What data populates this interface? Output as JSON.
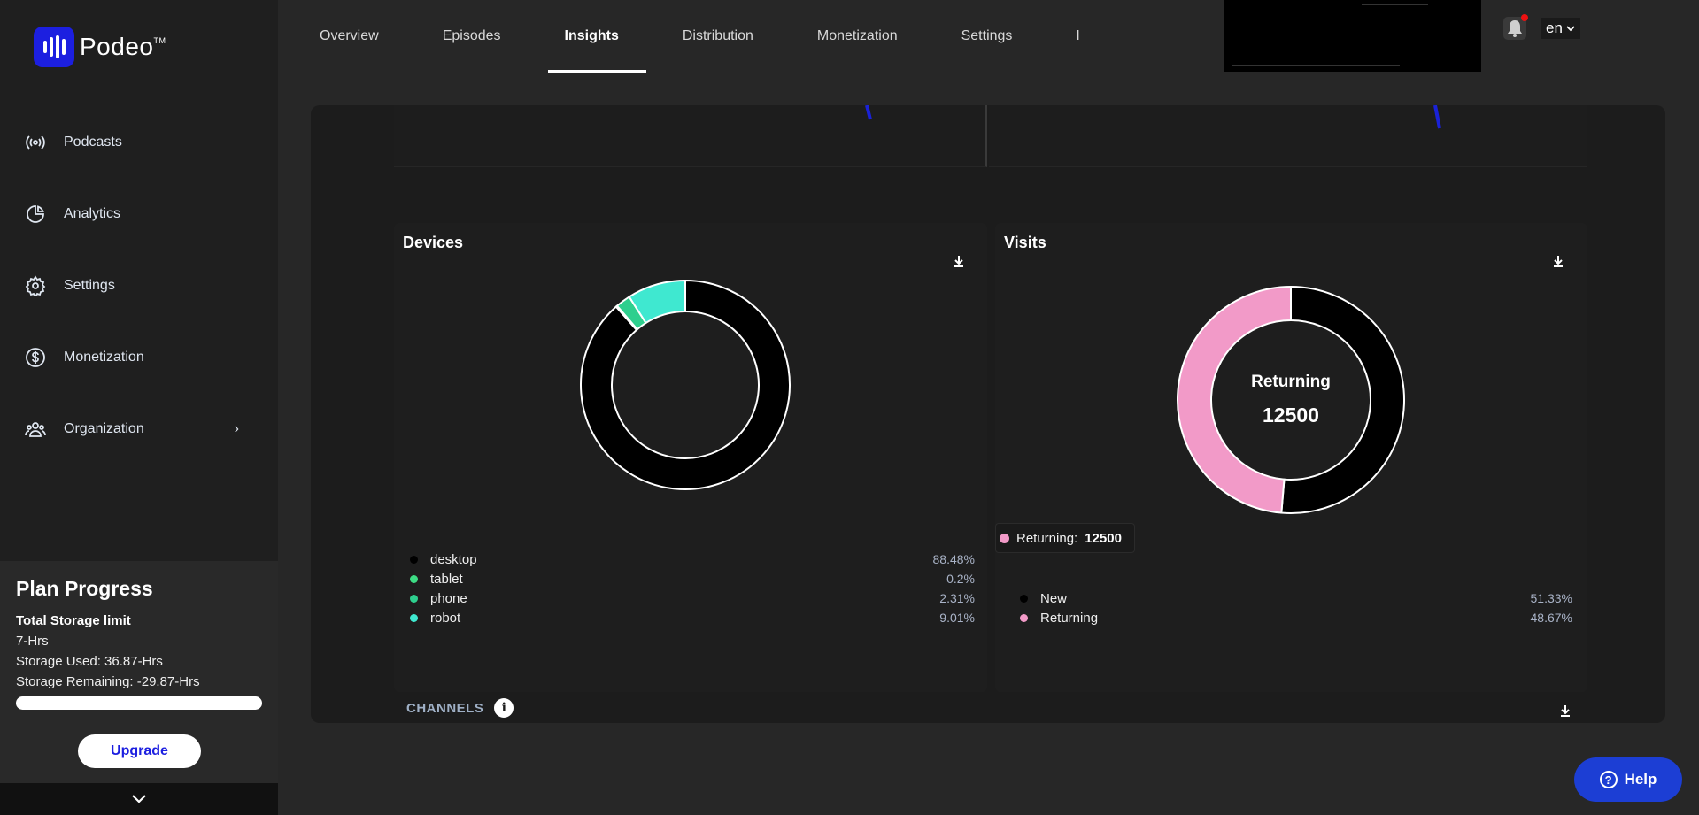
{
  "brand": {
    "name": "Podeo",
    "tm": "TM"
  },
  "sidebar": {
    "items": [
      {
        "label": "Podcasts",
        "icon": "broadcast-icon"
      },
      {
        "label": "Analytics",
        "icon": "pie-chart-icon"
      },
      {
        "label": "Settings",
        "icon": "gear-icon"
      },
      {
        "label": "Monetization",
        "icon": "dollar-icon"
      },
      {
        "label": "Organization",
        "icon": "people-icon"
      }
    ],
    "plan": {
      "title": "Plan Progress",
      "storage_title": "Total Storage limit",
      "limit": "7-Hrs",
      "used": "Storage Used: 36.87-Hrs",
      "remaining": "Storage Remaining: -29.87-Hrs",
      "progress_fraction": 1.0,
      "upgrade_label": "Upgrade"
    }
  },
  "tabs": [
    {
      "label": "Overview",
      "active": false
    },
    {
      "label": "Episodes",
      "active": false
    },
    {
      "label": "Insights",
      "active": true
    },
    {
      "label": "Distribution",
      "active": false
    },
    {
      "label": "Monetization",
      "active": false
    },
    {
      "label": "Settings",
      "active": false
    },
    {
      "label": "I",
      "active": false
    }
  ],
  "header": {
    "language": "en"
  },
  "devices": {
    "title": "Devices",
    "legend": [
      {
        "label": "desktop",
        "value": "88.48%",
        "color": "#000000",
        "pct": 88.48
      },
      {
        "label": "tablet",
        "value": "0.2%",
        "color": "#3ddc84",
        "pct": 0.2
      },
      {
        "label": "phone",
        "value": "2.31%",
        "color": "#2ecf8e",
        "pct": 2.31
      },
      {
        "label": "robot",
        "value": "9.01%",
        "color": "#3fe8d0",
        "pct": 9.01
      }
    ]
  },
  "visits": {
    "title": "Visits",
    "center_label": "Returning",
    "center_value": "12500",
    "tooltip_label": "Returning:",
    "tooltip_value": "12500",
    "legend": [
      {
        "label": "New",
        "value": "51.33%",
        "color": "#000000",
        "pct": 51.33
      },
      {
        "label": "Returning",
        "value": "48.67%",
        "color": "#f29ac8",
        "pct": 48.67
      }
    ]
  },
  "channels": {
    "label": "CHANNELS",
    "info": "i"
  },
  "help": {
    "label": "Help"
  }
}
